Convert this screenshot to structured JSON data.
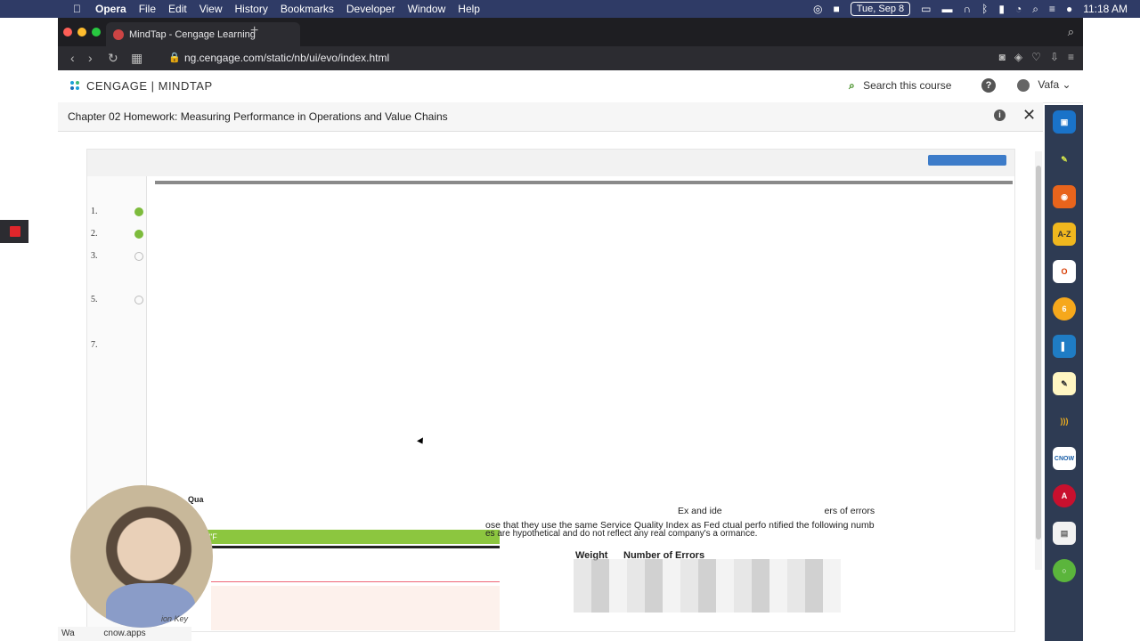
{
  "menubar": {
    "apple_icon": "apple-icon",
    "app_name": "Opera",
    "items": [
      "File",
      "Edit",
      "View",
      "History",
      "Bookmarks",
      "Developer",
      "Window",
      "Help"
    ],
    "date": "Tue, Sep 8",
    "time": "11:18 AM"
  },
  "browser": {
    "tab_title": "MindTap - Cengage Learning",
    "new_tab": "+",
    "url": "ng.cengage.com/static/nb/ui/evo/index.html"
  },
  "header": {
    "logo_text": "CENGAGE | MINDTAP",
    "search_label": "Search this course",
    "help_label": "?",
    "user_name": "Vafa"
  },
  "titlebar": {
    "title": "Chapter 02 Homework: Measuring Performance in Operations and Value Chains",
    "info_label": "i",
    "close_label": "✕"
  },
  "questions": {
    "items": [
      {
        "label": "1.",
        "status": "done"
      },
      {
        "label": "2.",
        "status": "done"
      },
      {
        "label": "3.",
        "status": "open"
      },
      {
        "label": "5.",
        "status": "open"
      },
      {
        "label": "7.",
        "status": ""
      }
    ]
  },
  "body": {
    "green_bar_label": "\"F",
    "text_line1": "ose that they use the same Service Quality Index as Fed",
    "text_line1b": "Ex and ide",
    "text_line1c": "ntified the following numb",
    "text_line1d": "ers of errors",
    "text_line2": "ctual perfo",
    "text_line3": "es are hypothetical and do not reflect any real company's a",
    "text_line3b": "ormance.",
    "sqi_label": "Qua",
    "table_header_weight": "Weight",
    "table_header_errors": "Number of Errors",
    "action_key": "ion Key"
  },
  "statusbar": {
    "text": "Wa",
    "url_fragment": "cnow.apps"
  }
}
